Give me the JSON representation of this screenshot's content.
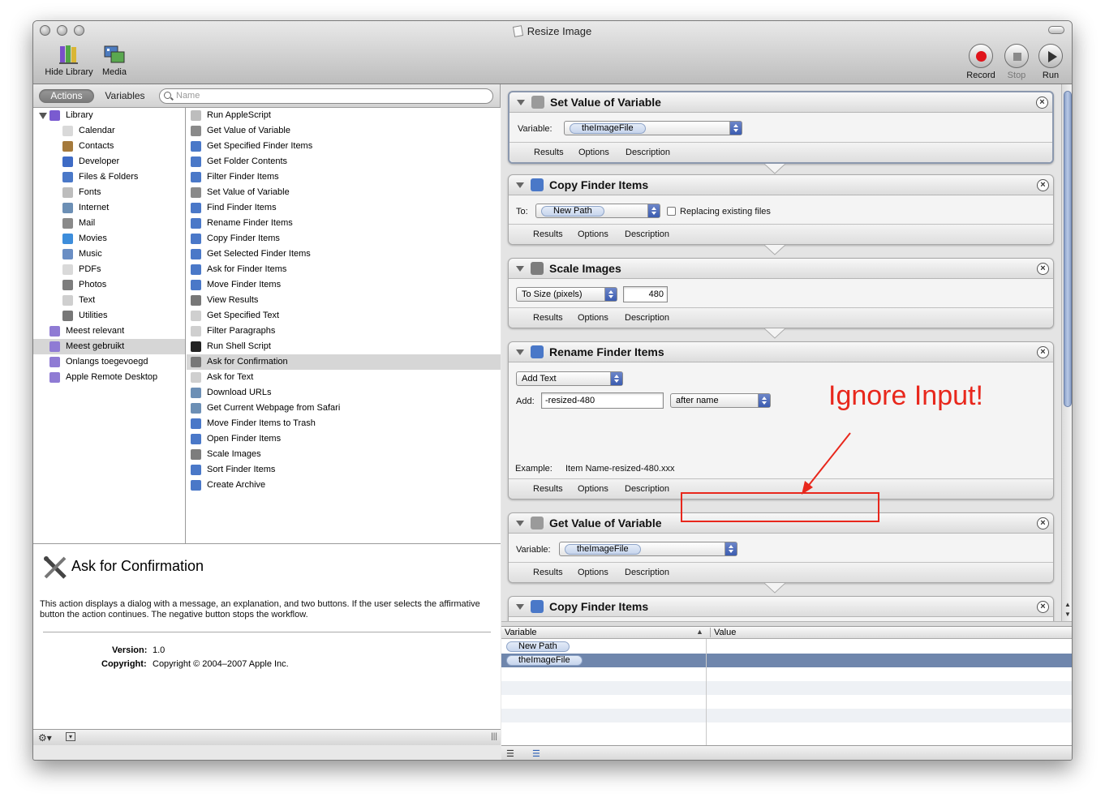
{
  "window": {
    "title": "Resize Image"
  },
  "toolbar": {
    "hide_library": "Hide Library",
    "media": "Media",
    "record": "Record",
    "stop": "Stop",
    "run": "Run"
  },
  "library_bar": {
    "actions": "Actions",
    "variables": "Variables",
    "search_placeholder": "Name"
  },
  "library": [
    {
      "label": "Library",
      "icon": "library-icon",
      "color": "#7a5bd0"
    },
    {
      "label": "Calendar",
      "icon": "calendar-icon",
      "color": "#d9d9d9"
    },
    {
      "label": "Contacts",
      "icon": "contacts-icon",
      "color": "#a57a3c"
    },
    {
      "label": "Developer",
      "icon": "developer-icon",
      "color": "#3e6bc5"
    },
    {
      "label": "Files & Folders",
      "icon": "finder-icon",
      "color": "#4a78c8"
    },
    {
      "label": "Fonts",
      "icon": "fonts-icon",
      "color": "#bdbdbd"
    },
    {
      "label": "Internet",
      "icon": "internet-icon",
      "color": "#6c8fb5"
    },
    {
      "label": "Mail",
      "icon": "mail-icon",
      "color": "#8a8a8a"
    },
    {
      "label": "Movies",
      "icon": "movies-icon",
      "color": "#3d8ddb"
    },
    {
      "label": "Music",
      "icon": "music-icon",
      "color": "#6a8ec4"
    },
    {
      "label": "PDFs",
      "icon": "pdf-icon",
      "color": "#d9d9d9"
    },
    {
      "label": "Photos",
      "icon": "photos-icon",
      "color": "#7d7d7d"
    },
    {
      "label": "Text",
      "icon": "text-icon",
      "color": "#cfcfcf"
    },
    {
      "label": "Utilities",
      "icon": "utilities-icon",
      "color": "#777777"
    },
    {
      "label": "Meest relevant",
      "icon": "smart-folder-icon",
      "color": "#8f7bd4"
    },
    {
      "label": "Meest gebruikt",
      "icon": "smart-folder-icon",
      "color": "#8f7bd4"
    },
    {
      "label": "Onlangs toegevoegd",
      "icon": "smart-folder-icon",
      "color": "#8f7bd4"
    },
    {
      "label": "Apple Remote Desktop",
      "icon": "smart-folder-icon",
      "color": "#8f7bd4"
    }
  ],
  "actions": [
    {
      "label": "Run AppleScript",
      "icon": "applescript-icon",
      "color": "#bdbdbd"
    },
    {
      "label": "Get Value of Variable",
      "icon": "variable-icon",
      "color": "#8a8a8a"
    },
    {
      "label": "Get Specified Finder Items",
      "icon": "finder-icon",
      "color": "#4a78c8"
    },
    {
      "label": "Get Folder Contents",
      "icon": "finder-icon",
      "color": "#4a78c8"
    },
    {
      "label": "Filter Finder Items",
      "icon": "finder-icon",
      "color": "#4a78c8"
    },
    {
      "label": "Set Value of Variable",
      "icon": "variable-icon",
      "color": "#8a8a8a"
    },
    {
      "label": "Find Finder Items",
      "icon": "finder-icon",
      "color": "#4a78c8"
    },
    {
      "label": "Rename Finder Items",
      "icon": "finder-icon",
      "color": "#4a78c8"
    },
    {
      "label": "Copy Finder Items",
      "icon": "finder-icon",
      "color": "#4a78c8"
    },
    {
      "label": "Get Selected Finder Items",
      "icon": "finder-icon",
      "color": "#4a78c8"
    },
    {
      "label": "Ask for Finder Items",
      "icon": "finder-icon",
      "color": "#4a78c8"
    },
    {
      "label": "Move Finder Items",
      "icon": "finder-icon",
      "color": "#4a78c8"
    },
    {
      "label": "View Results",
      "icon": "utilities-icon",
      "color": "#777777"
    },
    {
      "label": "Get Specified Text",
      "icon": "text-icon",
      "color": "#cfcfcf"
    },
    {
      "label": "Filter Paragraphs",
      "icon": "text-icon",
      "color": "#cfcfcf"
    },
    {
      "label": "Run Shell Script",
      "icon": "terminal-icon",
      "color": "#222222"
    },
    {
      "label": "Ask for Confirmation",
      "icon": "utilities-icon",
      "color": "#777777"
    },
    {
      "label": "Ask for Text",
      "icon": "text-icon",
      "color": "#cfcfcf"
    },
    {
      "label": "Download URLs",
      "icon": "internet-icon",
      "color": "#6c8fb5"
    },
    {
      "label": "Get Current Webpage from Safari",
      "icon": "internet-icon",
      "color": "#6c8fb5"
    },
    {
      "label": "Move Finder Items to Trash",
      "icon": "finder-icon",
      "color": "#4a78c8"
    },
    {
      "label": "Open Finder Items",
      "icon": "finder-icon",
      "color": "#4a78c8"
    },
    {
      "label": "Scale Images",
      "icon": "photos-icon",
      "color": "#7d7d7d"
    },
    {
      "label": "Sort Finder Items",
      "icon": "finder-icon",
      "color": "#4a78c8"
    },
    {
      "label": "Create Archive",
      "icon": "finder-icon",
      "color": "#4a78c8"
    }
  ],
  "description": {
    "title": "Ask for Confirmation",
    "text": "This action displays a dialog with a message, an explanation, and two buttons. If the user selects the affirmative button the action continues. The negative button stops the workflow.",
    "version_label": "Version:",
    "version": "1.0",
    "copyright_label": "Copyright:",
    "copyright": "Copyright © 2004–2007 Apple Inc."
  },
  "footer_tabs": {
    "results": "Results",
    "options": "Options",
    "description": "Description"
  },
  "workflow": {
    "set_var": {
      "title": "Set Value of Variable",
      "variable_label": "Variable:",
      "variable": "theImageFile"
    },
    "copy1": {
      "title": "Copy Finder Items",
      "to_label": "To:",
      "to": "New Path",
      "replace": "Replacing existing files",
      "replace_checked": false
    },
    "scale": {
      "title": "Scale Images",
      "mode": "To Size (pixels)",
      "size": "480"
    },
    "rename": {
      "title": "Rename Finder Items",
      "mode": "Add Text",
      "add_label": "Add:",
      "add": "-resized-480",
      "position": "after name",
      "example_label": "Example:",
      "example": "Item Name-resized-480.xxx"
    },
    "get_var": {
      "title": "Get Value of Variable",
      "variable_label": "Variable:",
      "variable": "theImageFile"
    },
    "copy2": {
      "title": "Copy Finder Items"
    }
  },
  "variables_table": {
    "col_variable": "Variable",
    "col_value": "Value",
    "rows": [
      "New Path",
      "theImageFile"
    ]
  },
  "annotation": {
    "text": "Ignore Input!",
    "color": "#e8271c"
  }
}
